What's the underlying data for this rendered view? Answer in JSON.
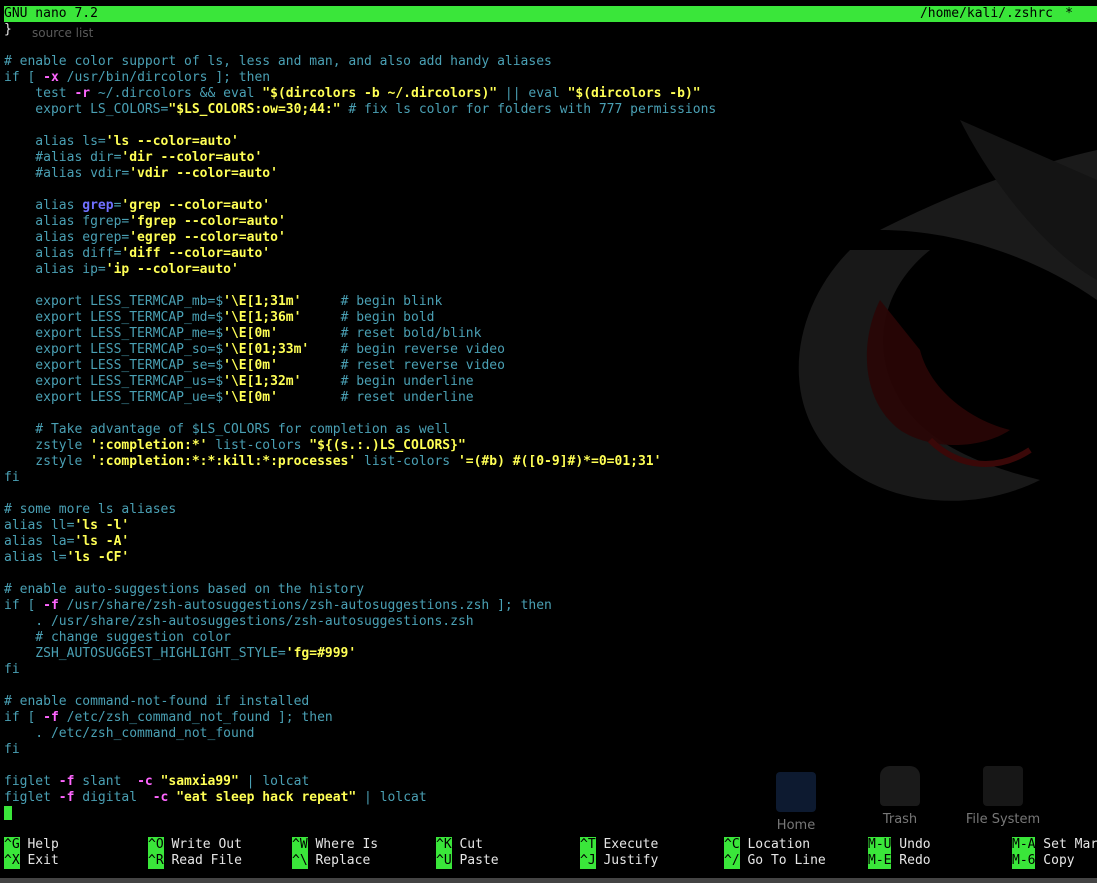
{
  "titlebar": {
    "app": "GNU nano 7.2",
    "path": "/home/kali/.zshrc",
    "modified": "*"
  },
  "ghost_text": "source list",
  "lines": [
    [
      {
        "t": "}",
        "c": "w"
      }
    ],
    [],
    [
      {
        "t": "# enable color support of ls, less and man, and also add handy aliases",
        "c": "c"
      }
    ],
    [
      {
        "t": "if [ ",
        "c": "k"
      },
      {
        "t": "-x",
        "c": "o"
      },
      {
        "t": " /usr/bin/dircolors ]; then",
        "c": "k"
      }
    ],
    [
      {
        "t": "    test ",
        "c": "k"
      },
      {
        "t": "-r",
        "c": "o"
      },
      {
        "t": " ~/.dircolors && eval ",
        "c": "k"
      },
      {
        "t": "\"$(dircolors -b ~/.dircolors)\"",
        "c": "s"
      },
      {
        "t": " || eval ",
        "c": "k"
      },
      {
        "t": "\"$(dircolors -b)\"",
        "c": "s"
      }
    ],
    [
      {
        "t": "    export LS_COLORS=",
        "c": "k"
      },
      {
        "t": "\"$LS_COLORS:ow=30;44:\"",
        "c": "s"
      },
      {
        "t": " # fix ls color for folders with 777 permissions",
        "c": "c"
      }
    ],
    [],
    [
      {
        "t": "    alias ls=",
        "c": "k"
      },
      {
        "t": "'ls --color=auto'",
        "c": "s"
      }
    ],
    [
      {
        "t": "    #alias dir=",
        "c": "k"
      },
      {
        "t": "'dir --color=auto'",
        "c": "s"
      }
    ],
    [
      {
        "t": "    #alias vdir=",
        "c": "k"
      },
      {
        "t": "'vdir --color=auto'",
        "c": "s"
      }
    ],
    [],
    [
      {
        "t": "    alias ",
        "c": "k"
      },
      {
        "t": "grep",
        "c": "g"
      },
      {
        "t": "=",
        "c": "k"
      },
      {
        "t": "'grep --color=auto'",
        "c": "s"
      }
    ],
    [
      {
        "t": "    alias fgrep=",
        "c": "k"
      },
      {
        "t": "'fgrep --color=auto'",
        "c": "s"
      }
    ],
    [
      {
        "t": "    alias egrep=",
        "c": "k"
      },
      {
        "t": "'egrep --color=auto'",
        "c": "s"
      }
    ],
    [
      {
        "t": "    alias diff=",
        "c": "k"
      },
      {
        "t": "'diff --color=auto'",
        "c": "s"
      }
    ],
    [
      {
        "t": "    alias ip=",
        "c": "k"
      },
      {
        "t": "'ip --color=auto'",
        "c": "s"
      }
    ],
    [],
    [
      {
        "t": "    export LESS_TERMCAP_mb=$",
        "c": "k"
      },
      {
        "t": "'\\E[1;31m'",
        "c": "s"
      },
      {
        "t": "     # begin blink",
        "c": "c"
      }
    ],
    [
      {
        "t": "    export LESS_TERMCAP_md=$",
        "c": "k"
      },
      {
        "t": "'\\E[1;36m'",
        "c": "s"
      },
      {
        "t": "     # begin bold",
        "c": "c"
      }
    ],
    [
      {
        "t": "    export LESS_TERMCAP_me=$",
        "c": "k"
      },
      {
        "t": "'\\E[0m'",
        "c": "s"
      },
      {
        "t": "        # reset bold/blink",
        "c": "c"
      }
    ],
    [
      {
        "t": "    export LESS_TERMCAP_so=$",
        "c": "k"
      },
      {
        "t": "'\\E[01;33m'",
        "c": "s"
      },
      {
        "t": "    # begin reverse video",
        "c": "c"
      }
    ],
    [
      {
        "t": "    export LESS_TERMCAP_se=$",
        "c": "k"
      },
      {
        "t": "'\\E[0m'",
        "c": "s"
      },
      {
        "t": "        # reset reverse video",
        "c": "c"
      }
    ],
    [
      {
        "t": "    export LESS_TERMCAP_us=$",
        "c": "k"
      },
      {
        "t": "'\\E[1;32m'",
        "c": "s"
      },
      {
        "t": "     # begin underline",
        "c": "c"
      }
    ],
    [
      {
        "t": "    export LESS_TERMCAP_ue=$",
        "c": "k"
      },
      {
        "t": "'\\E[0m'",
        "c": "s"
      },
      {
        "t": "        # reset underline",
        "c": "c"
      }
    ],
    [],
    [
      {
        "t": "    # Take advantage of $LS_COLORS for completion as well",
        "c": "c"
      }
    ],
    [
      {
        "t": "    zstyle ",
        "c": "k"
      },
      {
        "t": "':completion:*'",
        "c": "s"
      },
      {
        "t": " list-colors ",
        "c": "k"
      },
      {
        "t": "\"${(s.:.)LS_COLORS}\"",
        "c": "s"
      }
    ],
    [
      {
        "t": "    zstyle ",
        "c": "k"
      },
      {
        "t": "':completion:*:*:kill:*:processes'",
        "c": "s"
      },
      {
        "t": " list-colors ",
        "c": "k"
      },
      {
        "t": "'=(#b) #([0-9]#)*=0=01;31'",
        "c": "s"
      }
    ],
    [
      {
        "t": "fi",
        "c": "k"
      }
    ],
    [],
    [
      {
        "t": "# some more ls aliases",
        "c": "c"
      }
    ],
    [
      {
        "t": "alias ll=",
        "c": "k"
      },
      {
        "t": "'ls -l'",
        "c": "s"
      }
    ],
    [
      {
        "t": "alias la=",
        "c": "k"
      },
      {
        "t": "'ls -A'",
        "c": "s"
      }
    ],
    [
      {
        "t": "alias l=",
        "c": "k"
      },
      {
        "t": "'ls -CF'",
        "c": "s"
      }
    ],
    [],
    [
      {
        "t": "# enable auto-suggestions based on the history",
        "c": "c"
      }
    ],
    [
      {
        "t": "if [ ",
        "c": "k"
      },
      {
        "t": "-f",
        "c": "o"
      },
      {
        "t": " /usr/share/zsh-autosuggestions/zsh-autosuggestions.zsh ]; then",
        "c": "k"
      }
    ],
    [
      {
        "t": "    . /usr/share/zsh-autosuggestions/zsh-autosuggestions.zsh",
        "c": "k"
      }
    ],
    [
      {
        "t": "    # change suggestion color",
        "c": "c"
      }
    ],
    [
      {
        "t": "    ZSH_AUTOSUGGEST_HIGHLIGHT_STYLE=",
        "c": "k"
      },
      {
        "t": "'fg=#999'",
        "c": "s"
      }
    ],
    [
      {
        "t": "fi",
        "c": "k"
      }
    ],
    [],
    [
      {
        "t": "# enable command-not-found if installed",
        "c": "c"
      }
    ],
    [
      {
        "t": "if [ ",
        "c": "k"
      },
      {
        "t": "-f",
        "c": "o"
      },
      {
        "t": " /etc/zsh_command_not_found ]; then",
        "c": "k"
      }
    ],
    [
      {
        "t": "    . /etc/zsh_command_not_found",
        "c": "k"
      }
    ],
    [
      {
        "t": "fi",
        "c": "k"
      }
    ],
    [],
    [
      {
        "t": "figlet ",
        "c": "k"
      },
      {
        "t": "-f",
        "c": "o"
      },
      {
        "t": " slant  ",
        "c": "k"
      },
      {
        "t": "-c",
        "c": "o"
      },
      {
        "t": " ",
        "c": "k"
      },
      {
        "t": "\"samxia99\"",
        "c": "s"
      },
      {
        "t": " | lolcat",
        "c": "k"
      }
    ],
    [
      {
        "t": "figlet ",
        "c": "k"
      },
      {
        "t": "-f",
        "c": "o"
      },
      {
        "t": " digital  ",
        "c": "k"
      },
      {
        "t": "-c",
        "c": "o"
      },
      {
        "t": " ",
        "c": "k"
      },
      {
        "t": "\"eat sleep hack repeat\"",
        "c": "s"
      },
      {
        "t": " | lolcat",
        "c": "k"
      }
    ],
    [
      {
        "cursor": true
      }
    ]
  ],
  "desktop_icons": [
    {
      "label": "Home",
      "icon": "home-folder-icon"
    },
    {
      "label": "Trash",
      "icon": "trash-icon"
    },
    {
      "label": "File System",
      "icon": "drive-icon"
    }
  ],
  "shortcuts": [
    {
      "key": "^G",
      "label": "Help",
      "name": "help"
    },
    {
      "key": "^O",
      "label": "Write Out",
      "name": "write-out"
    },
    {
      "key": "^W",
      "label": "Where Is",
      "name": "where-is"
    },
    {
      "key": "^K",
      "label": "Cut",
      "name": "cut"
    },
    {
      "key": "^T",
      "label": "Execute",
      "name": "execute"
    },
    {
      "key": "^C",
      "label": "Location",
      "name": "location"
    },
    {
      "key": "M-U",
      "label": "Undo",
      "name": "undo"
    },
    {
      "key": "M-A",
      "label": "Set Mark",
      "name": "set-mark"
    },
    {
      "key": "^X",
      "label": "Exit",
      "name": "exit"
    },
    {
      "key": "^R",
      "label": "Read File",
      "name": "read-file"
    },
    {
      "key": "^\\",
      "label": "Replace",
      "name": "replace"
    },
    {
      "key": "^U",
      "label": "Paste",
      "name": "paste"
    },
    {
      "key": "^J",
      "label": "Justify",
      "name": "justify"
    },
    {
      "key": "^/",
      "label": "Go To Line",
      "name": "go-to-line"
    },
    {
      "key": "M-E",
      "label": "Redo",
      "name": "redo"
    },
    {
      "key": "M-6",
      "label": "Copy",
      "name": "copy"
    }
  ],
  "colors": {
    "accent_green": "#3ae63a",
    "comment": "#4aa0b4",
    "string": "#ffff55",
    "option": "#ff66ff"
  }
}
